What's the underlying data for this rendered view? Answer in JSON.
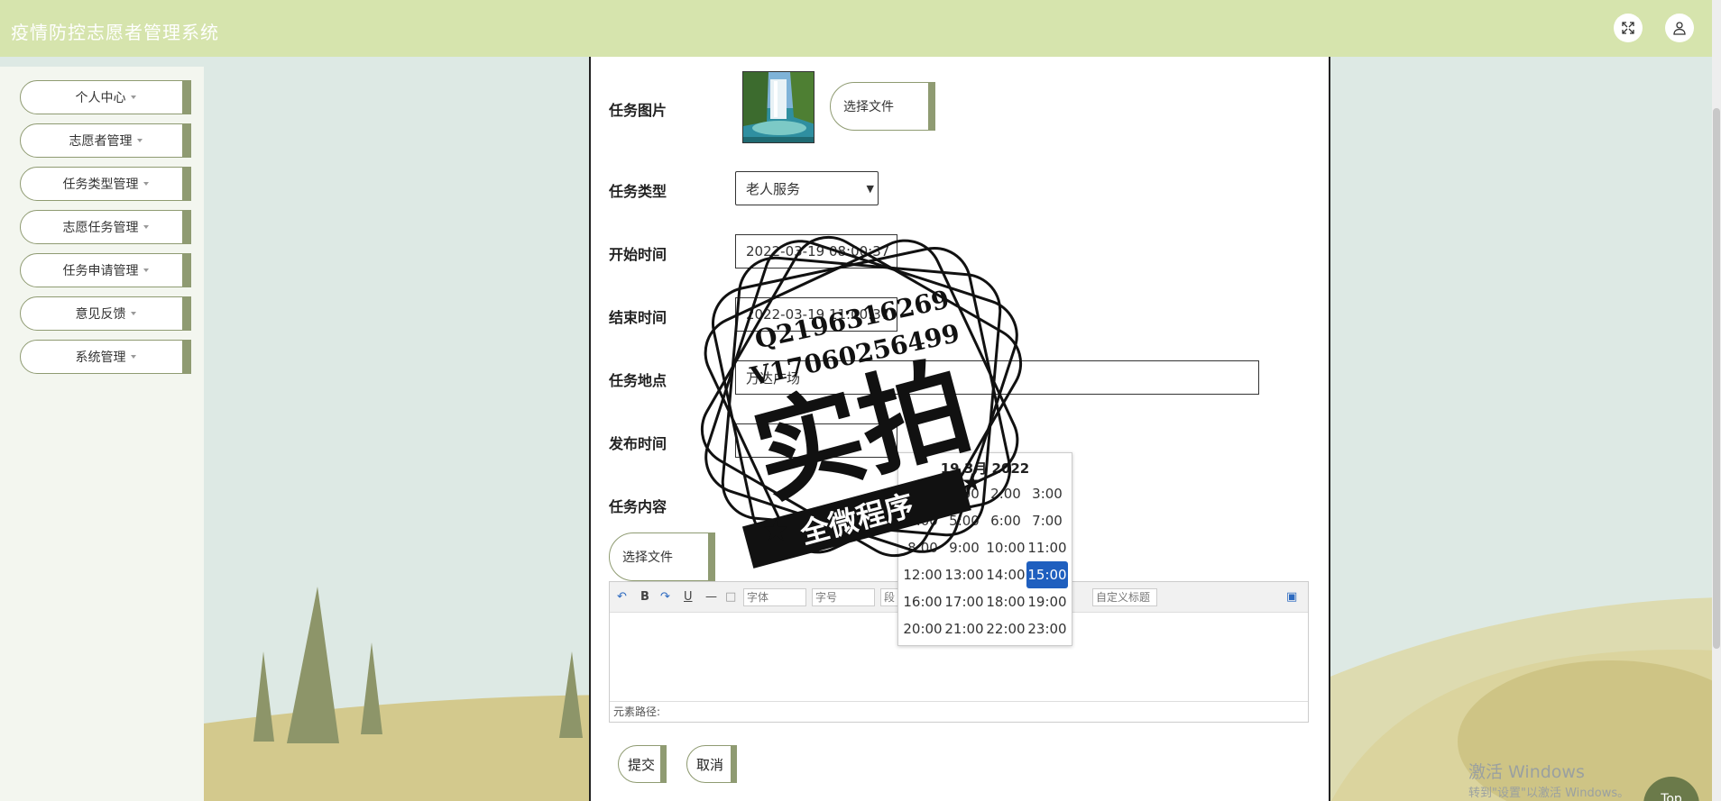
{
  "header": {
    "title": "疫情防控志愿者管理系统"
  },
  "sidebar": {
    "items": [
      {
        "label": "个人中心"
      },
      {
        "label": "志愿者管理"
      },
      {
        "label": "任务类型管理"
      },
      {
        "label": "志愿任务管理"
      },
      {
        "label": "任务申请管理"
      },
      {
        "label": "意见反馈"
      },
      {
        "label": "系统管理"
      }
    ]
  },
  "form": {
    "image_label": "任务图片",
    "file_button": "选择文件",
    "type_label": "任务类型",
    "type_value": "老人服务",
    "start_label": "开始时间",
    "start_value": "2022-03-19 08:00:37",
    "end_label": "结束时间",
    "end_value": "2022-03-19 11:00:37",
    "place_label": "任务地点",
    "place_value": "万达广场",
    "publish_label": "发布时间",
    "publish_value": "",
    "content_label": "任务内容",
    "content_file_button": "选择文件",
    "submit": "提交",
    "cancel": "取消"
  },
  "editor": {
    "font_select": "字体",
    "size_select": "字号",
    "para_select": "段",
    "heading_select": "自定义标题",
    "path_label": "元素路径:"
  },
  "timepicker": {
    "title": "19 3月 2022",
    "hours": [
      "0:00",
      "1:00",
      "2:00",
      "3:00",
      "4:00",
      "5:00",
      "6:00",
      "7:00",
      "8:00",
      "9:00",
      "10:00",
      "11:00",
      "12:00",
      "13:00",
      "14:00",
      "15:00",
      "16:00",
      "17:00",
      "18:00",
      "19:00",
      "20:00",
      "21:00",
      "22:00",
      "23:00"
    ],
    "selected": "15:00"
  },
  "watermark": {
    "line1": "Q2196316269",
    "line2": "V17060256499",
    "main": "实拍",
    "banner": "全微程序"
  },
  "windows": {
    "activate_title": "激活 Windows",
    "activate_sub": "转到\"设置\"以激活 Windows。"
  },
  "top_button": "Top",
  "colors": {
    "header_bg": "#d6e4ad",
    "accent": "#8f9b72",
    "selected_hour": "#1f5fbf"
  }
}
